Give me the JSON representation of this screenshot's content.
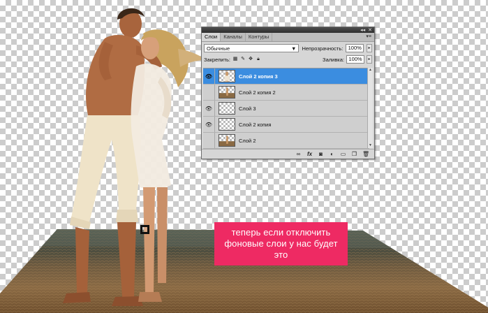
{
  "callout": {
    "text": "теперь если отключить фоновые слои у нас будет это"
  },
  "layers_panel": {
    "tabs": [
      {
        "label": "Слои",
        "active": true
      },
      {
        "label": "Каналы",
        "active": false
      },
      {
        "label": "Контуры",
        "active": false
      }
    ],
    "blend_mode": "Обычные",
    "opacity_label": "Непрозрачность:",
    "opacity_value": "100%",
    "lock_label": "Закрепить:",
    "fill_label": "Заливка:",
    "fill_value": "100%",
    "layers": [
      {
        "name": "Слой 2 копия 3",
        "visible": true,
        "selected": true,
        "thumb": "couple"
      },
      {
        "name": "Слой 2 копия 2",
        "visible": false,
        "selected": false,
        "thumb": "beach"
      },
      {
        "name": "Слой 3",
        "visible": true,
        "selected": false,
        "thumb": "empty"
      },
      {
        "name": "Слой 2 копия",
        "visible": true,
        "selected": false,
        "thumb": "empty"
      },
      {
        "name": "Слой 2",
        "visible": false,
        "selected": false,
        "thumb": "beach"
      }
    ],
    "footer_icons": [
      "link-icon",
      "fx-icon",
      "mask-icon",
      "adjustment-icon",
      "folder-icon",
      "new-layer-icon",
      "trash-icon"
    ]
  },
  "colors": {
    "accent_selected": "#3b8de0",
    "callout_bg": "#ee2a63"
  }
}
